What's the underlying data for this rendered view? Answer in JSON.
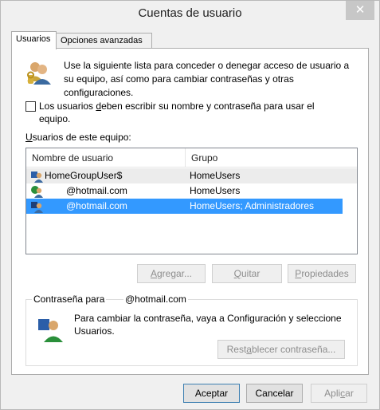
{
  "window": {
    "title": "Cuentas de usuario",
    "close_glyph": "✕"
  },
  "tabs": [
    {
      "label": "Usuarios"
    },
    {
      "label": "Opciones avanzadas"
    }
  ],
  "intro": {
    "text": "Use la siguiente lista para conceder o denegar acceso de usuario a su equipo, así como para cambiar contraseñas y otras configuraciones.",
    "icon": "users-icon"
  },
  "require_login": {
    "label_pre": "Los usuarios ",
    "label_u": "d",
    "label_post": "eben escribir su nombre y contraseña para usar el equipo.",
    "checked": false
  },
  "list": {
    "label_u": "U",
    "label_post": "suarios de este equipo:",
    "columns": [
      "Nombre de usuario",
      "Grupo"
    ],
    "rows": [
      {
        "name": "HomeGroupUser$",
        "group": "HomeUsers",
        "icon": "user-icon",
        "selected": false
      },
      {
        "name": "@hotmail.com",
        "group": "HomeUsers",
        "icon": "online-user-icon",
        "selected": false
      },
      {
        "name": "@hotmail.com",
        "group": "HomeUsers; Administradores",
        "icon": "user-icon",
        "selected": true
      }
    ]
  },
  "buttons": {
    "agregar": {
      "u": "A",
      "pre": "",
      "post": "gregar...",
      "full": "Agregar..."
    },
    "quitar": {
      "u": "Q",
      "pre": "",
      "post": "uitar"
    },
    "propiedades": {
      "u": "P",
      "pre": "",
      "post": "ropiedades"
    }
  },
  "password": {
    "legend": "Contraseña para",
    "email": "@hotmail.com",
    "text": "Para cambiar la contraseña, vaya a Configuración y seleccione Usuarios.",
    "reset_pre": "Rest",
    "reset_u": "a",
    "reset_post": "blecer contraseña..."
  },
  "footer": {
    "ok": "Aceptar",
    "cancel": "Cancelar",
    "apply_pre": "Apli",
    "apply_u": "c",
    "apply_post": "ar"
  },
  "colors": {
    "selection": "#3399ff",
    "disabled_text": "#8d8d8d"
  }
}
